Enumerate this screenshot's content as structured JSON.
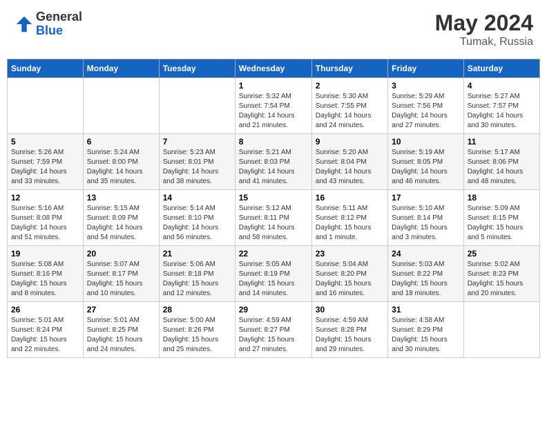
{
  "logo": {
    "general": "General",
    "blue": "Blue"
  },
  "title": {
    "month_year": "May 2024",
    "location": "Tumak, Russia"
  },
  "days_of_week": [
    "Sunday",
    "Monday",
    "Tuesday",
    "Wednesday",
    "Thursday",
    "Friday",
    "Saturday"
  ],
  "weeks": [
    [
      {
        "day": "",
        "info": ""
      },
      {
        "day": "",
        "info": ""
      },
      {
        "day": "",
        "info": ""
      },
      {
        "day": "1",
        "info": "Sunrise: 5:32 AM\nSunset: 7:54 PM\nDaylight: 14 hours\nand 21 minutes."
      },
      {
        "day": "2",
        "info": "Sunrise: 5:30 AM\nSunset: 7:55 PM\nDaylight: 14 hours\nand 24 minutes."
      },
      {
        "day": "3",
        "info": "Sunrise: 5:29 AM\nSunset: 7:56 PM\nDaylight: 14 hours\nand 27 minutes."
      },
      {
        "day": "4",
        "info": "Sunrise: 5:27 AM\nSunset: 7:57 PM\nDaylight: 14 hours\nand 30 minutes."
      }
    ],
    [
      {
        "day": "5",
        "info": "Sunrise: 5:26 AM\nSunset: 7:59 PM\nDaylight: 14 hours\nand 33 minutes."
      },
      {
        "day": "6",
        "info": "Sunrise: 5:24 AM\nSunset: 8:00 PM\nDaylight: 14 hours\nand 35 minutes."
      },
      {
        "day": "7",
        "info": "Sunrise: 5:23 AM\nSunset: 8:01 PM\nDaylight: 14 hours\nand 38 minutes."
      },
      {
        "day": "8",
        "info": "Sunrise: 5:21 AM\nSunset: 8:03 PM\nDaylight: 14 hours\nand 41 minutes."
      },
      {
        "day": "9",
        "info": "Sunrise: 5:20 AM\nSunset: 8:04 PM\nDaylight: 14 hours\nand 43 minutes."
      },
      {
        "day": "10",
        "info": "Sunrise: 5:19 AM\nSunset: 8:05 PM\nDaylight: 14 hours\nand 46 minutes."
      },
      {
        "day": "11",
        "info": "Sunrise: 5:17 AM\nSunset: 8:06 PM\nDaylight: 14 hours\nand 48 minutes."
      }
    ],
    [
      {
        "day": "12",
        "info": "Sunrise: 5:16 AM\nSunset: 8:08 PM\nDaylight: 14 hours\nand 51 minutes."
      },
      {
        "day": "13",
        "info": "Sunrise: 5:15 AM\nSunset: 8:09 PM\nDaylight: 14 hours\nand 54 minutes."
      },
      {
        "day": "14",
        "info": "Sunrise: 5:14 AM\nSunset: 8:10 PM\nDaylight: 14 hours\nand 56 minutes."
      },
      {
        "day": "15",
        "info": "Sunrise: 5:12 AM\nSunset: 8:11 PM\nDaylight: 14 hours\nand 58 minutes."
      },
      {
        "day": "16",
        "info": "Sunrise: 5:11 AM\nSunset: 8:12 PM\nDaylight: 15 hours\nand 1 minute."
      },
      {
        "day": "17",
        "info": "Sunrise: 5:10 AM\nSunset: 8:14 PM\nDaylight: 15 hours\nand 3 minutes."
      },
      {
        "day": "18",
        "info": "Sunrise: 5:09 AM\nSunset: 8:15 PM\nDaylight: 15 hours\nand 5 minutes."
      }
    ],
    [
      {
        "day": "19",
        "info": "Sunrise: 5:08 AM\nSunset: 8:16 PM\nDaylight: 15 hours\nand 8 minutes."
      },
      {
        "day": "20",
        "info": "Sunrise: 5:07 AM\nSunset: 8:17 PM\nDaylight: 15 hours\nand 10 minutes."
      },
      {
        "day": "21",
        "info": "Sunrise: 5:06 AM\nSunset: 8:18 PM\nDaylight: 15 hours\nand 12 minutes."
      },
      {
        "day": "22",
        "info": "Sunrise: 5:05 AM\nSunset: 8:19 PM\nDaylight: 15 hours\nand 14 minutes."
      },
      {
        "day": "23",
        "info": "Sunrise: 5:04 AM\nSunset: 8:20 PM\nDaylight: 15 hours\nand 16 minutes."
      },
      {
        "day": "24",
        "info": "Sunrise: 5:03 AM\nSunset: 8:22 PM\nDaylight: 15 hours\nand 18 minutes."
      },
      {
        "day": "25",
        "info": "Sunrise: 5:02 AM\nSunset: 8:23 PM\nDaylight: 15 hours\nand 20 minutes."
      }
    ],
    [
      {
        "day": "26",
        "info": "Sunrise: 5:01 AM\nSunset: 8:24 PM\nDaylight: 15 hours\nand 22 minutes."
      },
      {
        "day": "27",
        "info": "Sunrise: 5:01 AM\nSunset: 8:25 PM\nDaylight: 15 hours\nand 24 minutes."
      },
      {
        "day": "28",
        "info": "Sunrise: 5:00 AM\nSunset: 8:26 PM\nDaylight: 15 hours\nand 25 minutes."
      },
      {
        "day": "29",
        "info": "Sunrise: 4:59 AM\nSunset: 8:27 PM\nDaylight: 15 hours\nand 27 minutes."
      },
      {
        "day": "30",
        "info": "Sunrise: 4:59 AM\nSunset: 8:28 PM\nDaylight: 15 hours\nand 29 minutes."
      },
      {
        "day": "31",
        "info": "Sunrise: 4:58 AM\nSunset: 8:29 PM\nDaylight: 15 hours\nand 30 minutes."
      },
      {
        "day": "",
        "info": ""
      }
    ]
  ]
}
